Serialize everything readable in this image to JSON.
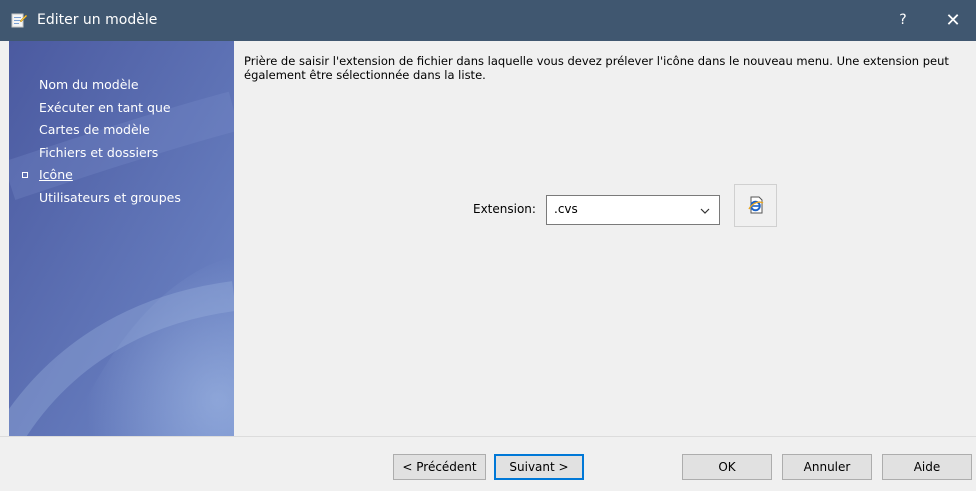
{
  "window": {
    "title": "Editer un modèle",
    "help_label": "?",
    "close_label": "✕",
    "app_icon": "template-edit-icon"
  },
  "sidebar": {
    "items": [
      {
        "label": "Nom du modèle",
        "active": false
      },
      {
        "label": "Exécuter en tant que",
        "active": false
      },
      {
        "label": "Cartes de modèle",
        "active": false
      },
      {
        "label": "Fichiers et dossiers",
        "active": false
      },
      {
        "label": "Icône",
        "active": true
      },
      {
        "label": "Utilisateurs et groupes",
        "active": false
      }
    ]
  },
  "main": {
    "instructions": "Prière de saisir l'extension de fichier dans laquelle vous devez prélever l'icône dans le nouveau menu. Une extension peut également être sélectionnée dans la liste.",
    "extension_label": "Extension:",
    "extension_value": ".cvs",
    "preview_icon": "ie-document-icon"
  },
  "footer": {
    "prev_label": "< Précédent",
    "next_label": "Suivant >",
    "ok_label": "OK",
    "cancel_label": "Annuler",
    "help_label": "Aide"
  },
  "colors": {
    "titlebar": "#405770",
    "sidebar": "#5163a6",
    "accent": "#0078d7"
  }
}
